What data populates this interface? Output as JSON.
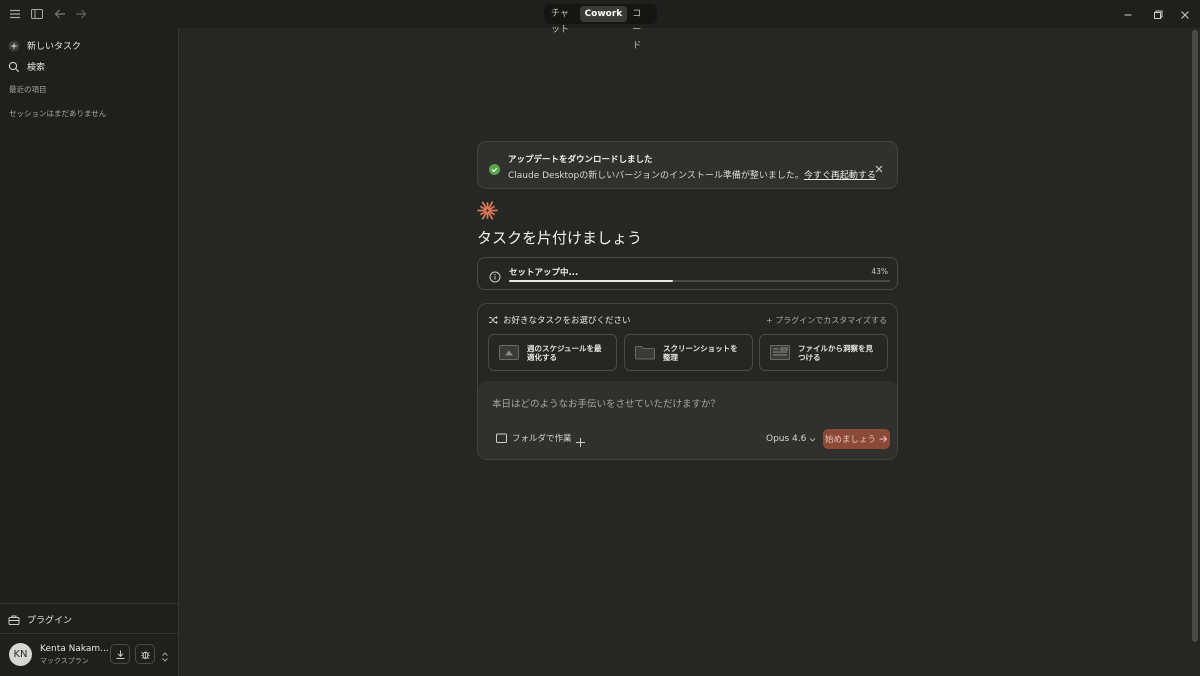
{
  "window": {
    "mode_tabs": [
      {
        "label": "チャット",
        "active": false
      },
      {
        "label": "Cowork",
        "active": true
      },
      {
        "label": "コード",
        "active": false
      }
    ]
  },
  "sidebar": {
    "new_task": "新しいタスク",
    "search": "検索",
    "recents_heading": "最近の項目",
    "empty_sessions": "セッションはまだありません",
    "plugins": "プラグイン",
    "user": {
      "initials": "KN",
      "name": "Kenta Nakam...",
      "plan": "マックスプラン"
    }
  },
  "notice": {
    "title": "アップデートをダウンロードしました",
    "body": "Claude Desktopの新しいバージョンのインストール準備が整いました。",
    "link": "今すぐ再起動する"
  },
  "main": {
    "headline": "タスクを片付けましょう",
    "setup": {
      "label": "セットアップ中...",
      "percent_text": "43%",
      "progress": 0.43
    },
    "tasks": {
      "heading": "お好きなタスクをお選びください",
      "plugins_link": "+ プラグインでカスタマイズする",
      "cards": [
        {
          "label": "週のスケジュールを最適化する",
          "icon": "calendar-icon"
        },
        {
          "label": "スクリーンショットを整理",
          "icon": "folder-icon"
        },
        {
          "label": "ファイルから洞察を見つける",
          "icon": "document-icon"
        }
      ]
    },
    "composer": {
      "placeholder": "本日はどのようなお手伝いをさせていただけますか？",
      "folder_label": "フォルダで作業",
      "model": "Opus 4.6",
      "start_label": "始めましょう"
    }
  },
  "colors": {
    "accent": "#d97757",
    "success": "#57a64a",
    "start_button": "#8b4a38"
  }
}
